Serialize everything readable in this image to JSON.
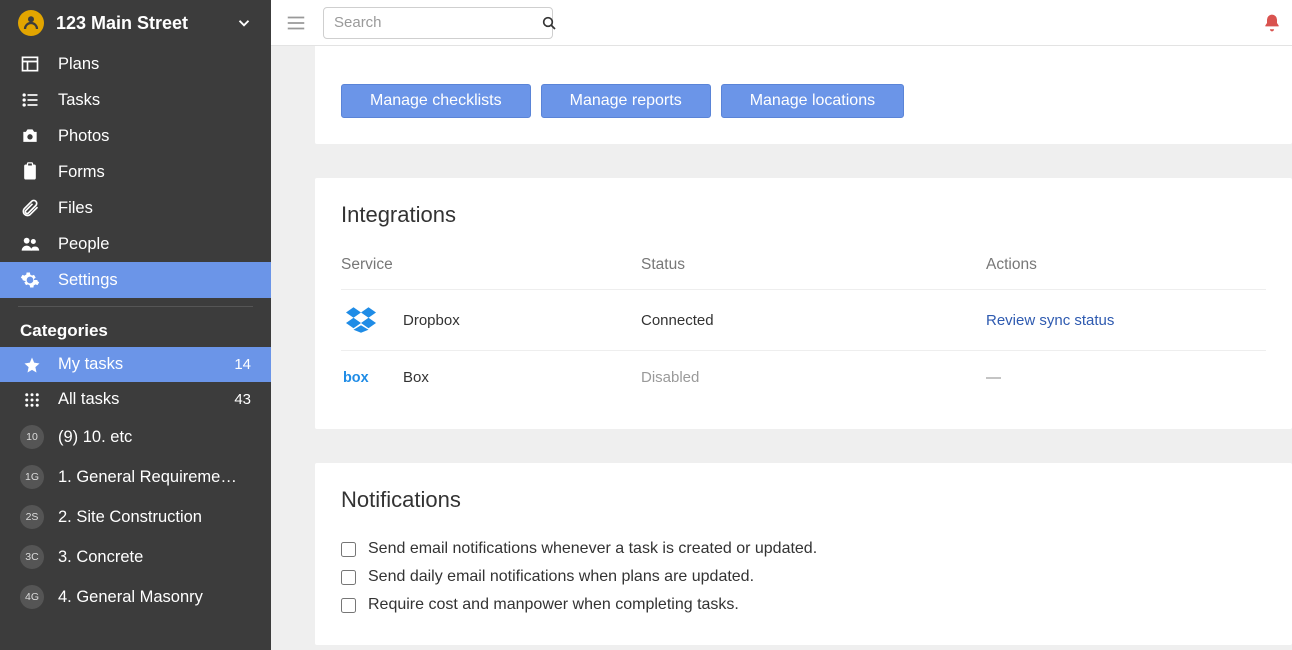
{
  "project": {
    "title": "123 Main Street"
  },
  "search": {
    "placeholder": "Search"
  },
  "sidebar": {
    "nav": [
      {
        "label": "Plans"
      },
      {
        "label": "Tasks"
      },
      {
        "label": "Photos"
      },
      {
        "label": "Forms"
      },
      {
        "label": "Files"
      },
      {
        "label": "People"
      },
      {
        "label": "Settings"
      }
    ],
    "categories_title": "Categories",
    "categories": [
      {
        "label": "My tasks",
        "count": "14"
      },
      {
        "label": "All tasks",
        "count": "43"
      },
      {
        "chip": "10",
        "label": "(9) 10. etc"
      },
      {
        "chip": "1G",
        "label": "1. General Requireme…"
      },
      {
        "chip": "2S",
        "label": "2. Site Construction"
      },
      {
        "chip": "3C",
        "label": "3. Concrete"
      },
      {
        "chip": "4G",
        "label": "4. General Masonry"
      }
    ]
  },
  "buttons": {
    "manage_checklists": "Manage checklists",
    "manage_reports": "Manage reports",
    "manage_locations": "Manage locations"
  },
  "integrations": {
    "title": "Integrations",
    "head": {
      "service": "Service",
      "status": "Status",
      "actions": "Actions"
    },
    "rows": [
      {
        "name": "Dropbox",
        "status": "Connected",
        "status_kind": "connected",
        "action": "Review sync status"
      },
      {
        "name": "Box",
        "status": "Disabled",
        "status_kind": "disabled",
        "action": "—"
      }
    ]
  },
  "notifications": {
    "title": "Notifications",
    "items": [
      "Send email notifications whenever a task is created or updated.",
      "Send daily email notifications when plans are updated.",
      "Require cost and manpower when completing tasks."
    ]
  }
}
